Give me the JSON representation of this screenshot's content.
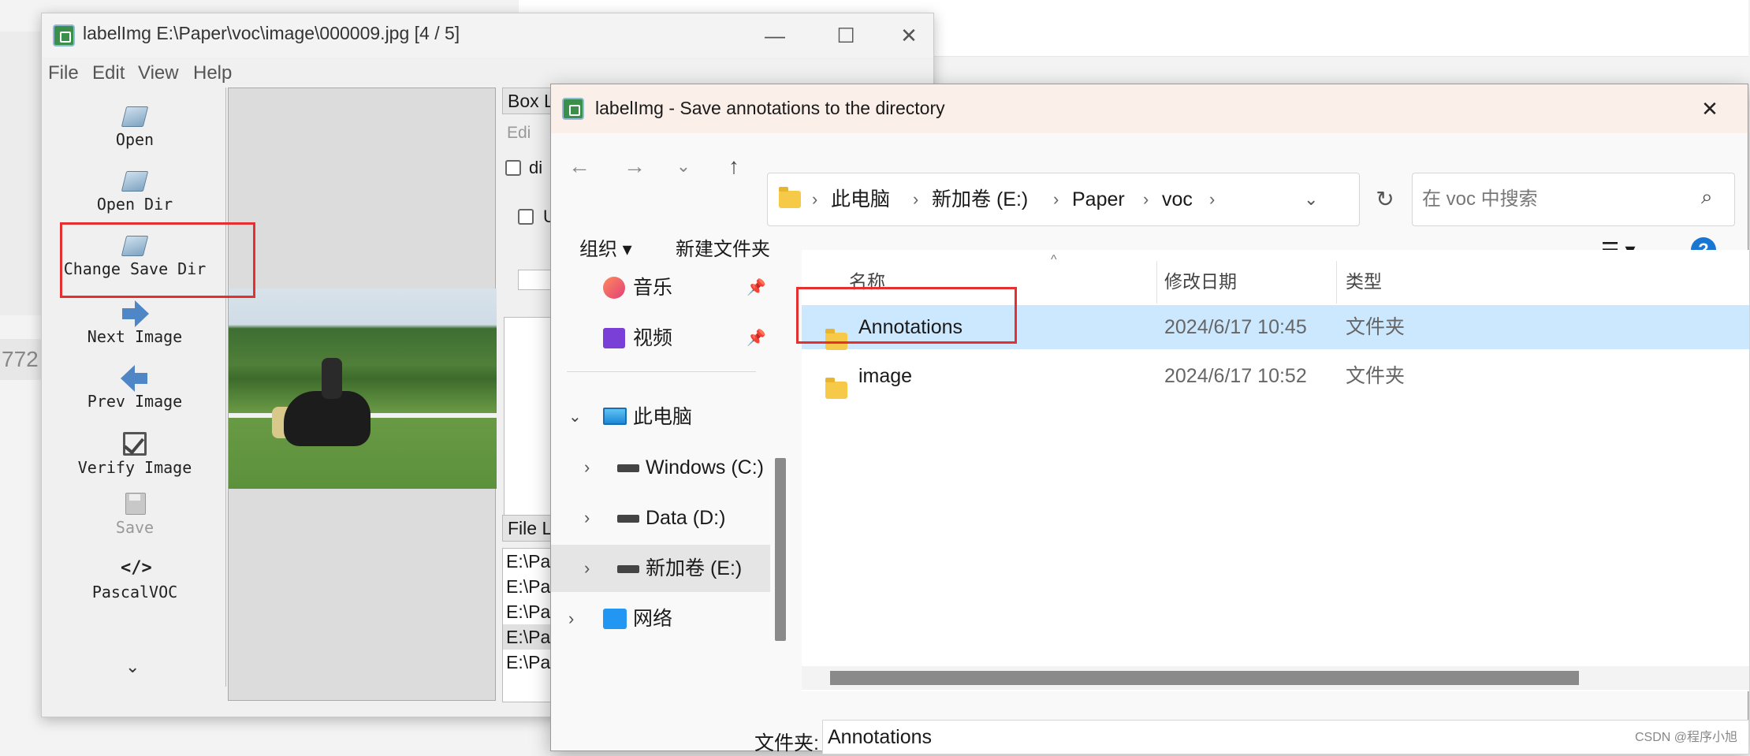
{
  "background": {
    "fragment_left": "772",
    "fragment_top": "…"
  },
  "labelimg": {
    "title": "labelImg E:\\Paper\\voc\\image\\000009.jpg [4 / 5]",
    "window_controls": {
      "minimize": "—",
      "maximize": "☐",
      "close": "✕"
    },
    "menu": [
      "File",
      "Edit",
      "View",
      "Help"
    ],
    "tools": [
      {
        "label": "Open",
        "icon": "folder-open-icon"
      },
      {
        "label": "Open Dir",
        "icon": "folder-open-icon"
      },
      {
        "label": "Change Save Dir",
        "icon": "folder-open-icon"
      },
      {
        "label": "Next Image",
        "icon": "arrow-right-icon"
      },
      {
        "label": "Prev Image",
        "icon": "arrow-left-icon"
      },
      {
        "label": "Verify Image",
        "icon": "checkbox-icon"
      },
      {
        "label": "Save",
        "icon": "save-icon"
      },
      {
        "label": "PascalVOC",
        "icon": "code-icon"
      }
    ],
    "expand_glyph": "⌄",
    "box_panel_title": "Box L",
    "edit_label": "Edi",
    "difficult_label": "di",
    "use_default_label": "U",
    "file_list_title": "File L",
    "file_list": [
      "E:\\Pa",
      "E:\\Pa",
      "E:\\Pa",
      "E:\\Pa",
      "E:\\Pa"
    ],
    "file_list_selected_index": 3
  },
  "dialog": {
    "title": "labelImg - Save annotations to the directory",
    "close_glyph": "✕",
    "nav": {
      "back": "←",
      "forward": "→",
      "recent": "⌄",
      "up": "↑"
    },
    "breadcrumb": [
      "此电脑",
      "新加卷 (E:)",
      "Paper",
      "voc"
    ],
    "breadcrumb_sep": "›",
    "search_placeholder": "在 voc 中搜索",
    "commands": {
      "organize": "组织",
      "new_folder": "新建文件夹",
      "help": "?"
    },
    "nav_pane": {
      "quick": [
        {
          "label": "音乐",
          "icon": "music-icon"
        },
        {
          "label": "视频",
          "icon": "video-icon"
        }
      ],
      "tree": [
        {
          "label": "此电脑",
          "icon": "computer-icon"
        },
        {
          "label": "Windows (C:)",
          "icon": "drive-icon"
        },
        {
          "label": "Data (D:)",
          "icon": "drive-icon"
        },
        {
          "label": "新加卷 (E:)",
          "icon": "drive-icon"
        },
        {
          "label": "网络",
          "icon": "network-icon"
        }
      ]
    },
    "columns": {
      "name": "名称",
      "date": "修改日期",
      "type": "类型"
    },
    "files": [
      {
        "name": "Annotations",
        "date": "2024/6/17 10:45",
        "type": "文件夹"
      },
      {
        "name": "image",
        "date": "2024/6/17 10:52",
        "type": "文件夹"
      }
    ],
    "selected_file_index": 0,
    "footer_label": "文件夹:",
    "footer_value": "Annotations"
  },
  "watermark": "CSDN @程序小旭",
  "colors": {
    "highlight_box": "#e53030",
    "selection": "#cce8ff",
    "accent": "#1976d2"
  }
}
